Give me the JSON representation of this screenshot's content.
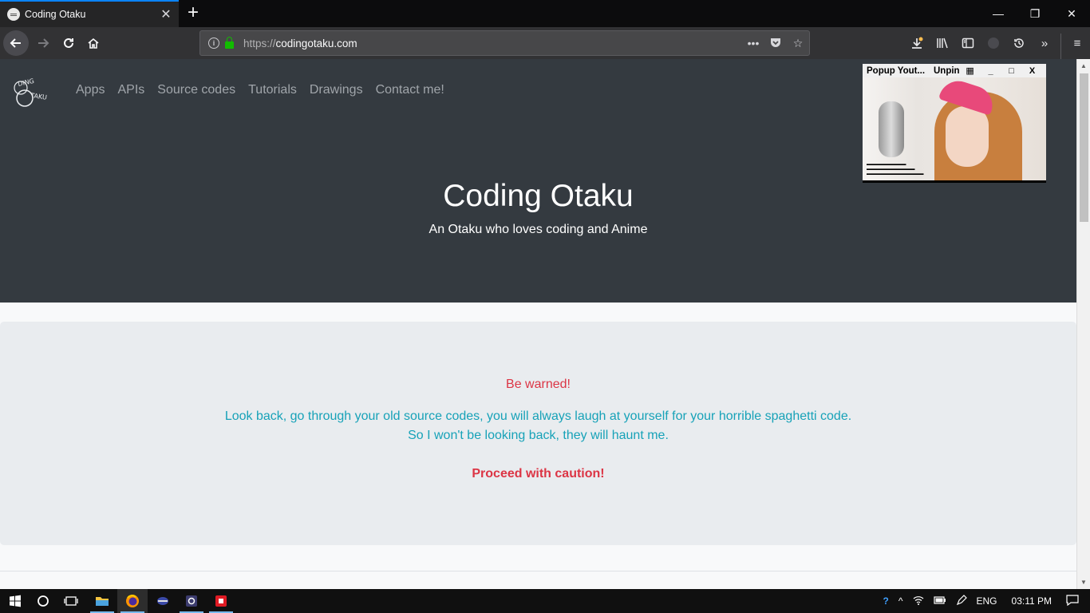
{
  "browser": {
    "tab_title": "Coding Otaku",
    "new_tab": "+",
    "url_scheme": "https://",
    "url_host": "codingotaku.com"
  },
  "site": {
    "logo_text": "CODING OTAKU",
    "nav": [
      "Apps",
      "APIs",
      "Source codes",
      "Tutorials",
      "Drawings",
      "Contact me!"
    ],
    "hero_title": "Coding Otaku",
    "hero_subtitle": "An Otaku who loves coding and Anime"
  },
  "notice": {
    "title": "Be warned!",
    "line1": "Look back, go through your old source codes, you will always laugh at yourself for your horrible spaghetti code.",
    "line2": "So I won't be looking back, they will haunt me.",
    "final": "Proceed with caution!"
  },
  "popup": {
    "title": "Popup Yout...",
    "unpin": "Unpin",
    "minimize": "_",
    "close": "X"
  },
  "taskbar": {
    "language": "ENG",
    "time": "03:11 PM"
  },
  "colors": {
    "hero_bg": "#343a40",
    "danger": "#dc3545",
    "info": "#17a2b8",
    "jumbotron_bg": "#e9ecef"
  }
}
